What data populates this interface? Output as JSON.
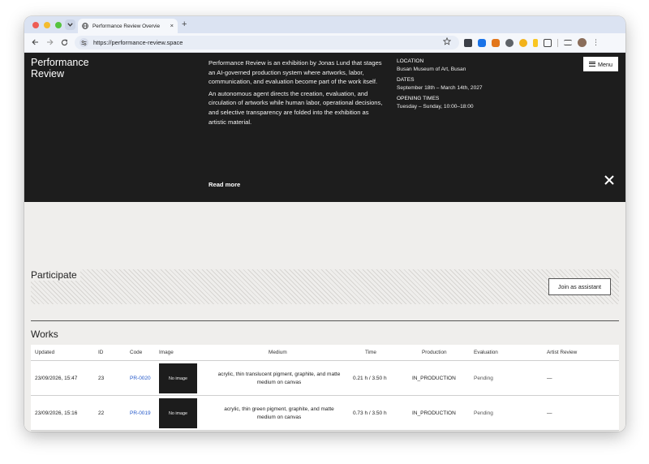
{
  "browser": {
    "tab_title": "Performance Review Overvie",
    "tab_close": "×",
    "new_tab": "+",
    "url": "https://performance-review.space"
  },
  "hero": {
    "title": "Performance Review",
    "desc_p1": "Performance Review is an exhibition by Jonas Lund that stages an AI-governed production system where artworks, labor, communication, and evaluation become part of the work itself.",
    "desc_p2": "An autonomous agent directs the creation, evaluation, and circulation of artworks while human labor, operational decisions, and selective transparency are folded into the exhibition as artistic material.",
    "read_more": "Read more",
    "menu_label": "Menu",
    "location_label": "LOCATION",
    "location_value": "Busan Museum of Art, Busan",
    "dates_label": "DATES",
    "dates_value": "September 18th – March 14th, 2027",
    "times_label": "OPENING TIMES",
    "times_value": "Tuesday – Sunday, 10:00–18:00"
  },
  "participate": {
    "title": "Participate",
    "join_label": "Join as assistant"
  },
  "works": {
    "title": "Works",
    "columns": [
      "Updated",
      "ID",
      "Code",
      "Image",
      "Medium",
      "Time",
      "Production",
      "Evaluation",
      "Artist Review"
    ],
    "rows": [
      {
        "updated": "23/09/2026, 15:47",
        "id": "23",
        "code": "PR-0020",
        "image": "No image",
        "medium": "acrylic, thin translucent pigment, graphite, and matte medium on canvas",
        "time": "0.21 h / 3.50 h",
        "production": "IN_PRODUCTION",
        "evaluation": "Pending",
        "artist_review": "—"
      },
      {
        "updated": "23/09/2026, 15:16",
        "id": "22",
        "code": "PR-0019",
        "image": "No image",
        "medium": "acrylic, thin green pigment, graphite, and matte medium on canvas",
        "time": "0.73 h / 3.50 h",
        "production": "IN_PRODUCTION",
        "evaluation": "Pending",
        "artist_review": "—"
      }
    ]
  }
}
